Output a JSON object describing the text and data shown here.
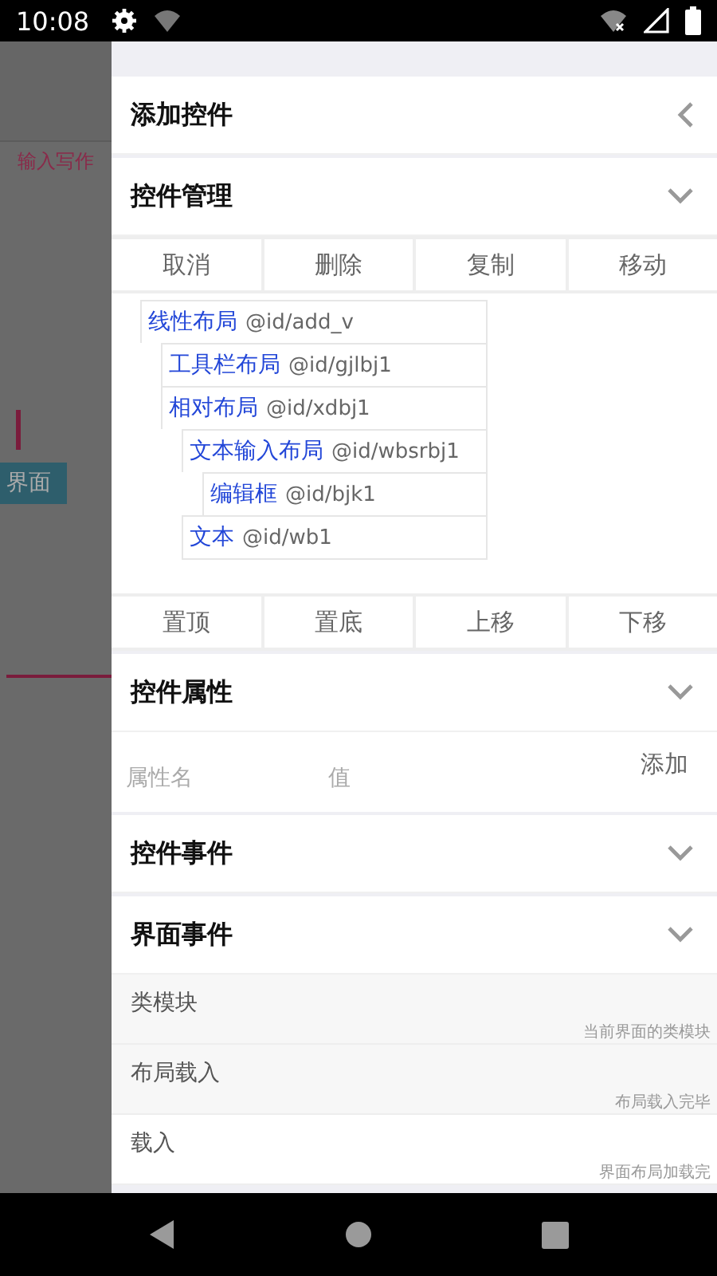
{
  "status_bar": {
    "time": "10:08"
  },
  "background_app": {
    "input_hint": "输入写作",
    "tab": "界面"
  },
  "drawer": {
    "sections": [
      {
        "title": "添加控件",
        "expanded": false
      },
      {
        "title": "控件管理",
        "expanded": true,
        "kind": "manage",
        "top_buttons": [
          "取消",
          "删除",
          "复制",
          "移动"
        ],
        "tree": [
          {
            "name": "线性布局",
            "id": "@id/add_v",
            "children": [
              {
                "name": "工具栏布局",
                "id": "@id/gjlbj1"
              },
              {
                "name": "相对布局",
                "id": "@id/xdbj1",
                "children": [
                  {
                    "name": "文本输入布局",
                    "id": "@id/wbsrbj1",
                    "children": [
                      {
                        "name": "编辑框",
                        "id": "@id/bjk1"
                      }
                    ]
                  },
                  {
                    "name": "文本",
                    "id": "@id/wb1"
                  }
                ]
              }
            ]
          }
        ],
        "bottom_buttons": [
          "置顶",
          "置底",
          "上移",
          "下移"
        ]
      },
      {
        "title": "控件属性",
        "expanded": true,
        "kind": "properties",
        "name_placeholder": "属性名",
        "value_placeholder": "值",
        "add_label": "添加"
      },
      {
        "title": "控件事件",
        "expanded": true
      },
      {
        "title": "界面事件",
        "expanded": true,
        "kind": "events",
        "items": [
          {
            "name": "类模块",
            "description": "当前界面的类模块"
          },
          {
            "name": "布局载入",
            "description": "布局载入完毕"
          },
          {
            "name": "载入",
            "description": "界面布局加载完"
          }
        ]
      }
    ]
  }
}
